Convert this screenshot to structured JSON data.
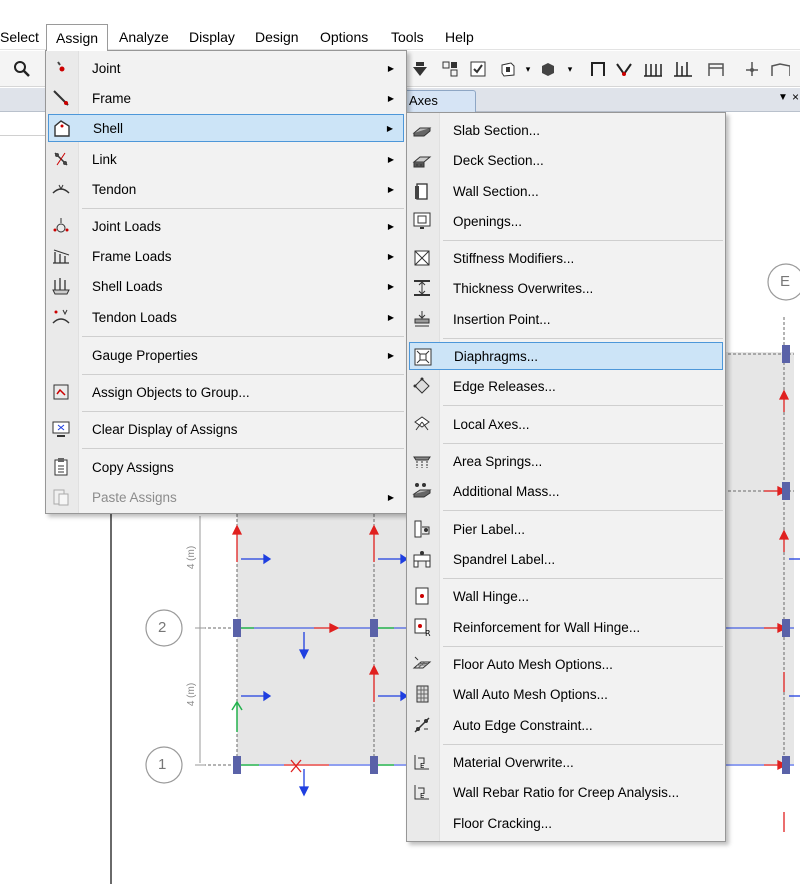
{
  "menubar": {
    "items": [
      "Select",
      "Assign",
      "Analyze",
      "Display",
      "Design",
      "Options",
      "Tools",
      "Help"
    ]
  },
  "tab": {
    "label": "Axes"
  },
  "assign_menu": {
    "items": [
      {
        "label": "Joint",
        "icon": "joint-icon",
        "submenu": true
      },
      {
        "label": "Frame",
        "icon": "frame-icon",
        "submenu": true
      },
      {
        "label": "Shell",
        "icon": "shell-icon",
        "submenu": true,
        "highlighted": true
      },
      {
        "label": "Link",
        "icon": "link-icon",
        "submenu": true
      },
      {
        "label": "Tendon",
        "icon": "tendon-icon",
        "submenu": true
      },
      {
        "label": "Joint Loads",
        "icon": "joint-loads-icon",
        "submenu": true
      },
      {
        "label": "Frame Loads",
        "icon": "frame-loads-icon",
        "submenu": true
      },
      {
        "label": "Shell Loads",
        "icon": "shell-loads-icon",
        "submenu": true
      },
      {
        "label": "Tendon Loads",
        "icon": "tendon-loads-icon",
        "submenu": true
      },
      {
        "label": "Gauge Properties",
        "icon": "",
        "submenu": true
      },
      {
        "label": "Assign Objects to Group...",
        "icon": "assign-group-icon",
        "submenu": false
      },
      {
        "label": "Clear Display of Assigns",
        "icon": "clear-display-icon",
        "submenu": false
      },
      {
        "label": "Copy Assigns",
        "icon": "copy-assigns-icon",
        "submenu": false
      },
      {
        "label": "Paste Assigns",
        "icon": "paste-assigns-icon",
        "submenu": true,
        "disabled": true
      }
    ]
  },
  "shell_submenu": {
    "items": [
      {
        "label": "Slab Section...",
        "icon": "slab-section-icon"
      },
      {
        "label": "Deck Section...",
        "icon": "deck-section-icon"
      },
      {
        "label": "Wall Section...",
        "icon": "wall-section-icon"
      },
      {
        "label": "Openings...",
        "icon": "openings-icon"
      },
      {
        "label": "Stiffness Modifiers...",
        "icon": "stiffness-modifiers-icon"
      },
      {
        "label": "Thickness Overwrites...",
        "icon": "thickness-overwrites-icon"
      },
      {
        "label": "Insertion Point...",
        "icon": "insertion-point-icon"
      },
      {
        "label": "Diaphragms...",
        "icon": "diaphragms-icon",
        "highlighted": true
      },
      {
        "label": "Edge Releases...",
        "icon": "edge-releases-icon"
      },
      {
        "label": "Local Axes...",
        "icon": "local-axes-icon"
      },
      {
        "label": "Area Springs...",
        "icon": "area-springs-icon"
      },
      {
        "label": "Additional Mass...",
        "icon": "additional-mass-icon"
      },
      {
        "label": "Pier Label...",
        "icon": "pier-label-icon"
      },
      {
        "label": "Spandrel Label...",
        "icon": "spandrel-label-icon"
      },
      {
        "label": "Wall Hinge...",
        "icon": "wall-hinge-icon"
      },
      {
        "label": "Reinforcement for Wall Hinge...",
        "icon": "wall-hinge-reinforcement-icon"
      },
      {
        "label": "Floor Auto Mesh Options...",
        "icon": "floor-auto-mesh-icon"
      },
      {
        "label": "Wall Auto Mesh Options...",
        "icon": "wall-auto-mesh-icon"
      },
      {
        "label": "Auto Edge Constraint...",
        "icon": "auto-edge-constraint-icon"
      },
      {
        "label": "Material Overwrite...",
        "icon": "material-overwrite-icon"
      },
      {
        "label": "Wall Rebar Ratio for Creep Analysis...",
        "icon": "wall-rebar-ratio-icon"
      },
      {
        "label": "Floor Cracking...",
        "icon": ""
      }
    ]
  },
  "canvas": {
    "grid_bubbles": [
      "2",
      "1",
      "E"
    ],
    "dimension_labels": [
      "4 (m)",
      "4 (m)"
    ]
  },
  "colors": {
    "menu_highlight": "#cce4f7",
    "menu_highlight_border": "#4d97d9",
    "shell_fill": "#e6e6e6",
    "joint": "#5a62a8",
    "load_arrow_blue": "#1f3fe0",
    "load_arrow_red": "#e0201f",
    "axis_green": "#22b14c"
  }
}
